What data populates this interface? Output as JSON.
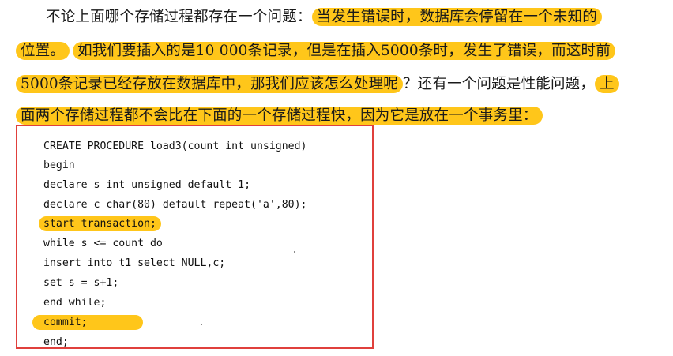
{
  "paragraph": {
    "line1_plain": "不论上面哪个存储过程都存在一个问题：",
    "line1_highlight": "当发生错误时，数据库会停留在一个未知的",
    "line2_highlight_a": "位置。",
    "line2_highlight_b": "如我们要插入的是10 000条记录，但是在插入5000条时，发生了错误，而这时前",
    "line3_highlight": "5000条记录已经存放在数据库中，那我们应该怎么处理呢",
    "line3_plain": "？还有一个问题是性能问题，",
    "line3_highlight_tail": "上",
    "line4_highlight": "面两个存储过程都不会比在下面的一个存储过程快，因为它是放在一个事务里："
  },
  "code": {
    "lines": [
      "CREATE PROCEDURE load3(count int unsigned)",
      "begin",
      "declare s int unsigned default 1;",
      "declare c char(80) default repeat('a',80);",
      "start transaction;",
      "while s <= count do",
      "insert into t1 select NULL,c;",
      "set s = s+1;",
      "end while;",
      "commit;",
      "end;"
    ]
  },
  "colors": {
    "highlight": "#ffc61a",
    "box_border": "#e0403c"
  }
}
